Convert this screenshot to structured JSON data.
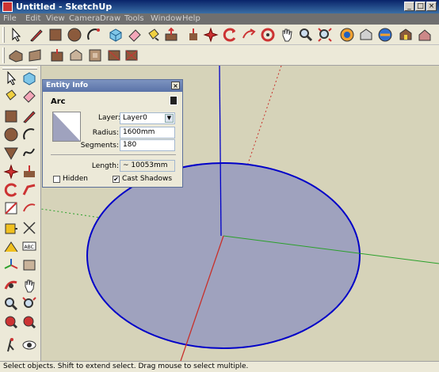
{
  "window": {
    "title": "Untitled - SketchUp"
  },
  "menu": [
    "File",
    "Edit",
    "View",
    "Camera",
    "Draw",
    "Tools",
    "Window",
    "Help"
  ],
  "toolbar_top": [
    "select-icon",
    "pencil-icon",
    "rectangle-icon",
    "circle-icon",
    "arc-icon",
    "make-component-icon",
    "eraser-icon",
    "paint-bucket-icon",
    "push-pull-icon",
    "move-icon",
    "rotate-icon",
    "offset-icon",
    "orbit-icon",
    "pan-icon",
    "zoom-icon",
    "zoom-extents-icon",
    "previous-view-icon",
    "next-view-icon",
    "get-models-icon",
    "share-model-icon"
  ],
  "toolbar_second": [
    "iso-view-icon",
    "top-view-icon",
    "front-view-icon",
    "right-view-icon",
    "back-view-icon",
    "left-view-icon"
  ],
  "entity_info": {
    "title": "Entity Info",
    "entity_type": "Arc",
    "layer_label": "Layer:",
    "layer_value": "Layer0",
    "radius_label": "Radius:",
    "radius_value": "1600mm",
    "segments_label": "Segments:",
    "segments_value": "180",
    "length_label": "Length:",
    "length_value": "~ 10053mm",
    "hidden_label": "Hidden",
    "hidden_checked": false,
    "cast_shadows_label": "Cast Shadows",
    "cast_shadows_checked": true
  },
  "status": {
    "text": "Select objects. Shift to extend select. Drag mouse to select multiple."
  },
  "colors": {
    "viewport_bg": "#d6d3b9",
    "ellipse_fill": "#9fa2be",
    "ellipse_stroke": "#0000c8",
    "axis_red": "#c8302a",
    "axis_green": "#2aa02a",
    "axis_blue": "#0000c8"
  }
}
